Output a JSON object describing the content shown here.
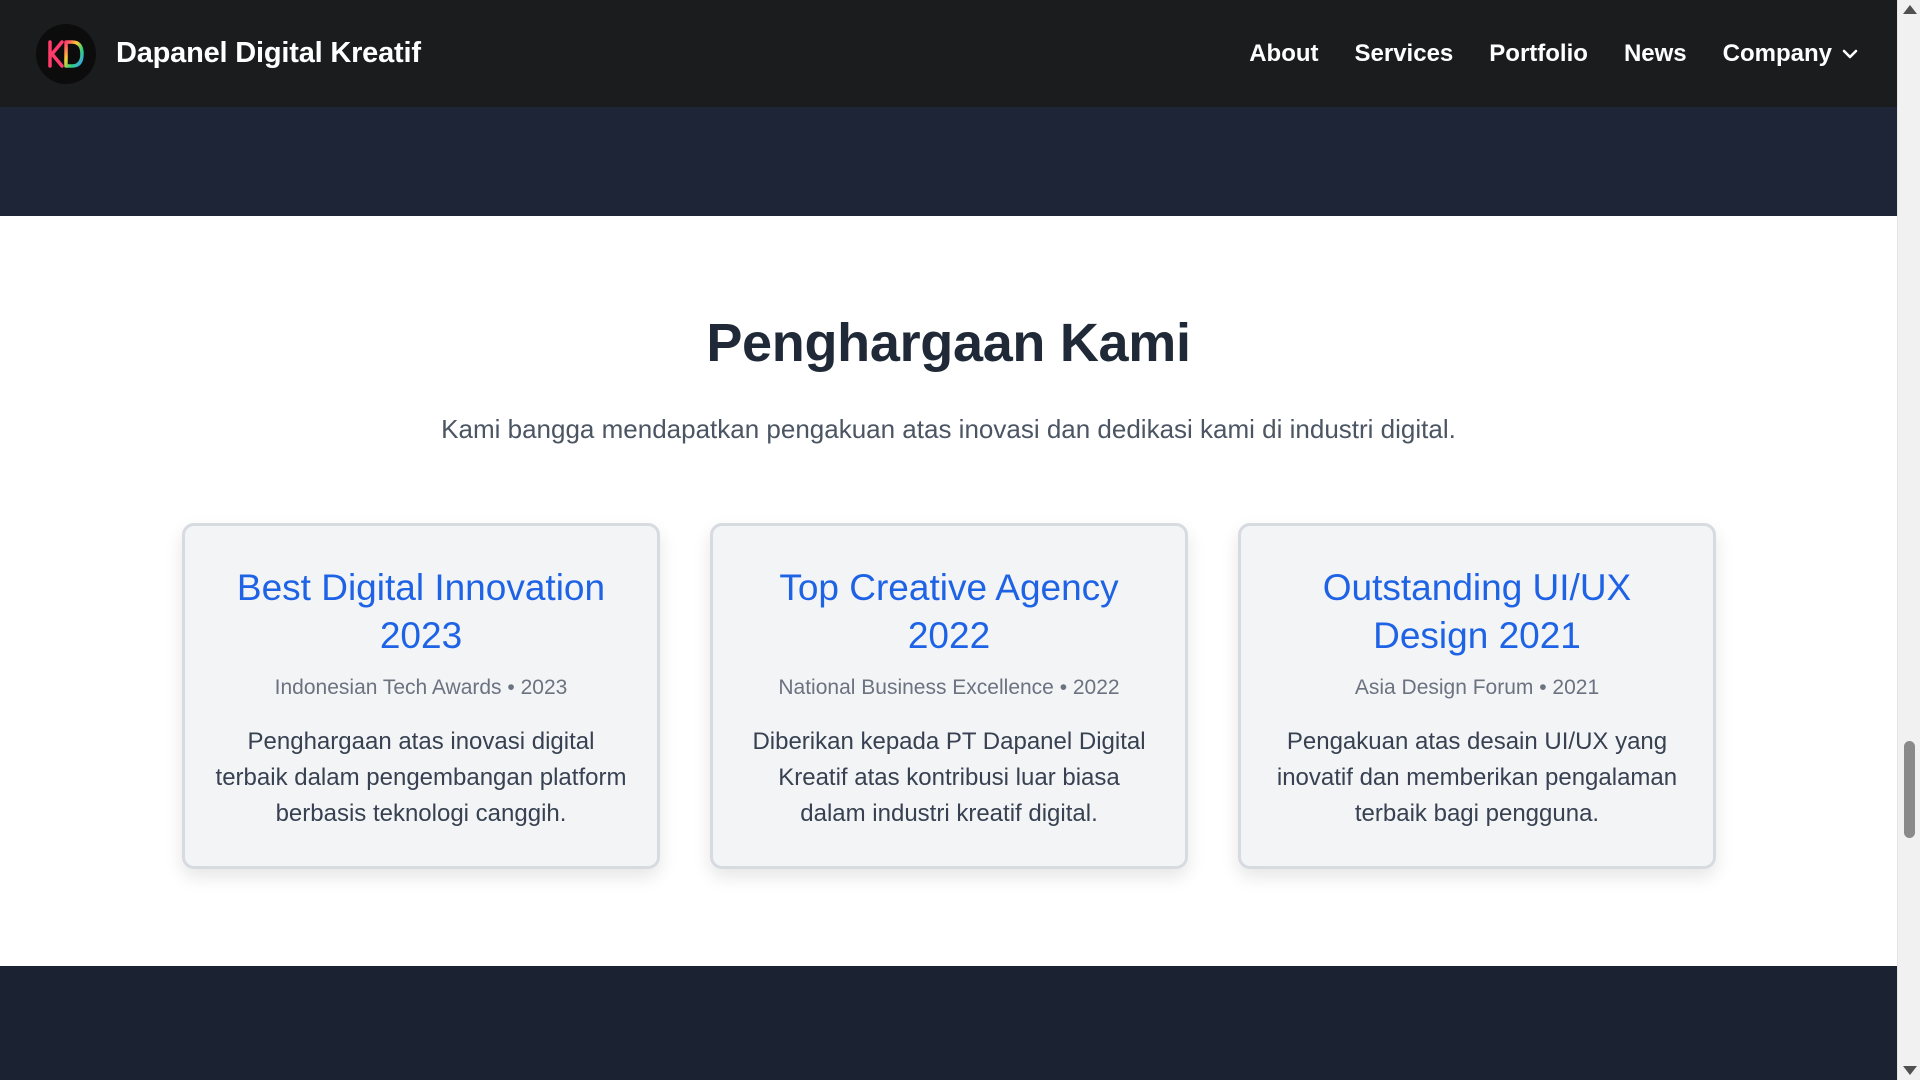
{
  "nav": {
    "brand_name": "Dapanel Digital Kreatif",
    "logo_text": "KD",
    "links": [
      {
        "label": "About"
      },
      {
        "label": "Services"
      },
      {
        "label": "Portfolio"
      },
      {
        "label": "News"
      },
      {
        "label": "Company"
      }
    ]
  },
  "awards": {
    "title": "Penghargaan Kami",
    "subtitle": "Kami bangga mendapatkan pengakuan atas inovasi dan dedikasi kami di industri digital.",
    "cards": [
      {
        "title": "Best Digital Innovation 2023",
        "meta": "Indonesian Tech Awards • 2023",
        "description": "Penghargaan atas inovasi digital terbaik dalam pengembangan platform berbasis teknologi canggih."
      },
      {
        "title": "Top Creative Agency 2022",
        "meta": "National Business Excellence • 2022",
        "description": "Diberikan kepada PT Dapanel Digital Kreatif atas kontribusi luar biasa dalam industri kreatif digital."
      },
      {
        "title": "Outstanding UI/UX Design 2021",
        "meta": "Asia Design Forum • 2021",
        "description": "Pengakuan atas desain UI/UX yang inovatif dan memberikan pengalaman terbaik bagi pengguna."
      }
    ]
  },
  "colors": {
    "navbar_bg": "#1b1c1e",
    "dark_band": "#1d2536",
    "accent_blue": "#1e63e6",
    "heading_text": "#1f2937",
    "card_bg": "#f3f4f6"
  },
  "icons": {
    "dropdown": "chevron-down-icon"
  }
}
